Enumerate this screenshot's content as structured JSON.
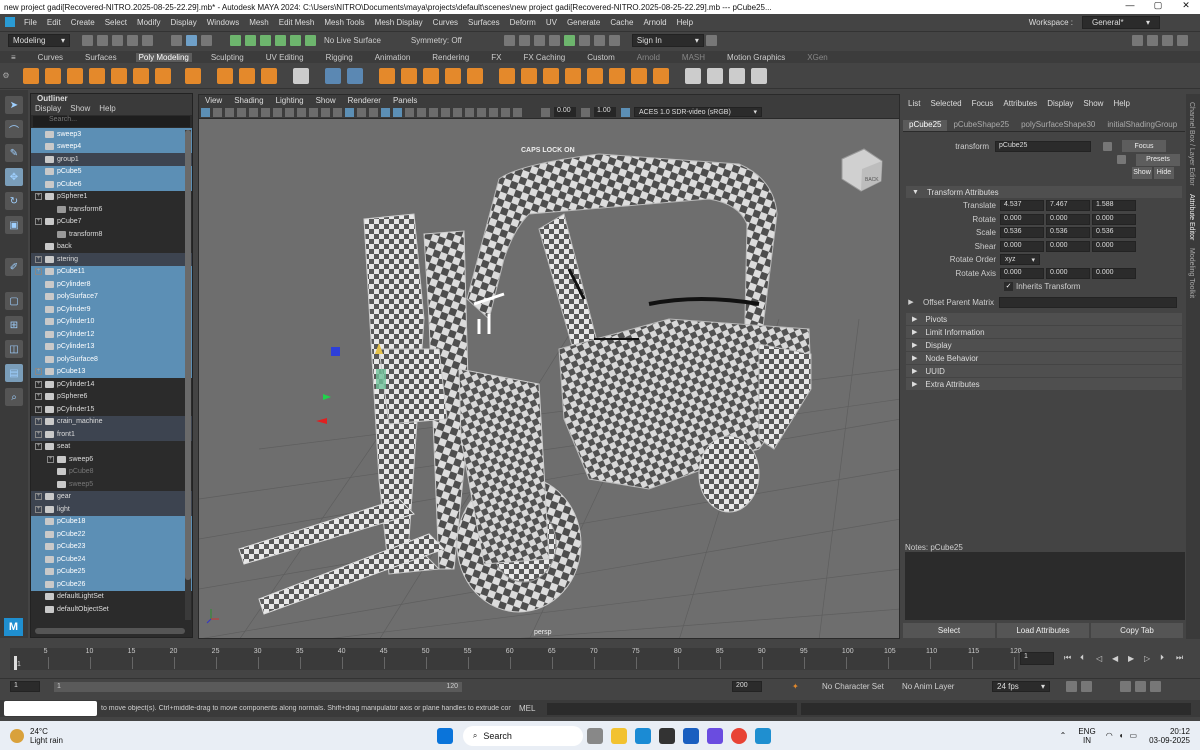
{
  "titlebar": {
    "title": "new project gadi[Recovered-NITRO.2025-08-25-22.29].mb* - Autodesk MAYA 2024: C:\\Users\\NITRO\\Documents\\maya\\projects\\default\\scenes\\new project gadi[Recovered-NITRO.2025-08-25-22.29].mb --- pCube25...",
    "minimize": "—",
    "maximize": "▢",
    "close": "✕"
  },
  "menu": [
    "File",
    "Edit",
    "Create",
    "Select",
    "Modify",
    "Display",
    "Windows",
    "Mesh",
    "Edit Mesh",
    "Mesh Tools",
    "Mesh Display",
    "Curves",
    "Surfaces",
    "Deform",
    "UV",
    "Generate",
    "Cache",
    "Arnold",
    "Help"
  ],
  "workspace": {
    "label": "Workspace :",
    "value": "General*"
  },
  "status": {
    "mode": "Modeling",
    "live_surface": "No Live Surface",
    "symmetry": "Symmetry: Off",
    "sign_in": "Sign In"
  },
  "shelf_tabs": [
    "Curves",
    "Surfaces",
    "Poly Modeling",
    "Sculpting",
    "UV Editing",
    "Rigging",
    "Animation",
    "Rendering",
    "FX",
    "FX Caching",
    "Custom",
    "Arnold",
    "MASH",
    "Motion Graphics",
    "XGen"
  ],
  "shelf_active": "Poly Modeling",
  "outliner": {
    "title": "Outliner",
    "menu": [
      "Display",
      "Show",
      "Help"
    ],
    "search_placeholder": "Search...",
    "items": [
      {
        "label": "sweep3",
        "sel": true,
        "indent": 0,
        "exp": false
      },
      {
        "label": "sweep4",
        "sel": true,
        "indent": 0,
        "exp": false
      },
      {
        "label": "group1",
        "sel": false,
        "indent": 0,
        "exp": false,
        "hl": true
      },
      {
        "label": "pCube5",
        "sel": true,
        "indent": 0,
        "exp": false
      },
      {
        "label": "pCube6",
        "sel": true,
        "indent": 0,
        "exp": false
      },
      {
        "label": "pSphere1",
        "sel": false,
        "indent": 0,
        "exp": true
      },
      {
        "label": "transform6",
        "sel": false,
        "indent": 1,
        "exp": false,
        "xf": true
      },
      {
        "label": "pCube7",
        "sel": false,
        "indent": 0,
        "exp": true
      },
      {
        "label": "transform8",
        "sel": false,
        "indent": 1,
        "exp": false,
        "xf": true
      },
      {
        "label": "back",
        "sel": false,
        "indent": 0,
        "exp": false
      },
      {
        "label": "stering",
        "sel": false,
        "indent": 0,
        "exp": true,
        "hl": true
      },
      {
        "label": "pCube11",
        "sel": true,
        "indent": 0,
        "exp": true
      },
      {
        "label": "pCylinder8",
        "sel": true,
        "indent": 0,
        "exp": false
      },
      {
        "label": "polySurface7",
        "sel": true,
        "indent": 0,
        "exp": false
      },
      {
        "label": "pCylinder9",
        "sel": true,
        "indent": 0,
        "exp": false
      },
      {
        "label": "pCylinder10",
        "sel": true,
        "indent": 0,
        "exp": false
      },
      {
        "label": "pCylinder12",
        "sel": true,
        "indent": 0,
        "exp": false
      },
      {
        "label": "pCylinder13",
        "sel": true,
        "indent": 0,
        "exp": false
      },
      {
        "label": "polySurface8",
        "sel": true,
        "indent": 0,
        "exp": false
      },
      {
        "label": "pCube13",
        "sel": true,
        "indent": 0,
        "exp": true
      },
      {
        "label": "pCylinder14",
        "sel": false,
        "indent": 0,
        "exp": true
      },
      {
        "label": "pSphere6",
        "sel": false,
        "indent": 0,
        "exp": true
      },
      {
        "label": "pCylinder15",
        "sel": false,
        "indent": 0,
        "exp": true
      },
      {
        "label": "crain_machine",
        "sel": false,
        "indent": 0,
        "exp": true,
        "hl": true
      },
      {
        "label": "front1",
        "sel": false,
        "indent": 0,
        "exp": true,
        "hl": true
      },
      {
        "label": "seat",
        "sel": false,
        "indent": 0,
        "exp": true
      },
      {
        "label": "sweep6",
        "sel": false,
        "indent": 1,
        "exp": true
      },
      {
        "label": "pCube8",
        "sel": false,
        "indent": 1,
        "exp": false,
        "dim": true
      },
      {
        "label": "sweep5",
        "sel": false,
        "indent": 1,
        "exp": false,
        "dim": true
      },
      {
        "label": "gear",
        "sel": false,
        "indent": 0,
        "exp": true,
        "hl": true
      },
      {
        "label": "light",
        "sel": false,
        "indent": 0,
        "exp": true,
        "hl": true
      },
      {
        "label": "pCube18",
        "sel": true,
        "indent": 0,
        "exp": false
      },
      {
        "label": "pCube22",
        "sel": true,
        "indent": 0,
        "exp": false
      },
      {
        "label": "pCube23",
        "sel": true,
        "indent": 0,
        "exp": false
      },
      {
        "label": "pCube24",
        "sel": true,
        "indent": 0,
        "exp": false
      },
      {
        "label": "pCube25",
        "sel": true,
        "indent": 0,
        "exp": false
      },
      {
        "label": "pCube26",
        "sel": true,
        "indent": 0,
        "exp": false
      },
      {
        "label": "defaultLightSet",
        "sel": false,
        "indent": 0,
        "exp": false
      },
      {
        "label": "defaultObjectSet",
        "sel": false,
        "indent": 0,
        "exp": false
      }
    ]
  },
  "viewport": {
    "menu": [
      "View",
      "Shading",
      "Lighting",
      "Show",
      "Renderer",
      "Panels"
    ],
    "exposure": "0.00",
    "gamma": "1.00",
    "colorspace": "ACES 1.0 SDR-video (sRGB)",
    "caps": "CAPS LOCK ON",
    "camera": "persp",
    "viewcube": "BACK"
  },
  "attr": {
    "menu": [
      "List",
      "Selected",
      "Focus",
      "Attributes",
      "Display",
      "Show",
      "Help"
    ],
    "tabs": [
      "pCube25",
      "pCubeShape25",
      "polySurfaceShape30",
      "initialShadingGroup"
    ],
    "transform_label": "transform",
    "transform_value": "pCube25",
    "btn_focus": "Focus",
    "btn_presets": "Presets",
    "btn_show": "Show",
    "btn_hide": "Hide",
    "section_transform": "Transform Attributes",
    "translate": {
      "label": "Translate",
      "x": "4.537",
      "y": "7.467",
      "z": "1.588"
    },
    "rotate": {
      "label": "Rotate",
      "x": "0.000",
      "y": "0.000",
      "z": "0.000"
    },
    "scale": {
      "label": "Scale",
      "x": "0.536",
      "y": "0.536",
      "z": "0.536"
    },
    "shear": {
      "label": "Shear",
      "x": "0.000",
      "y": "0.000",
      "z": "0.000"
    },
    "rotate_order": {
      "label": "Rotate Order",
      "value": "xyz"
    },
    "rotate_axis": {
      "label": "Rotate Axis",
      "x": "0.000",
      "y": "0.000",
      "z": "0.000"
    },
    "inherits": "Inherits Transform",
    "offset_parent": "Offset Parent Matrix",
    "sections": [
      "Pivots",
      "Limit Information",
      "Display",
      "Node Behavior",
      "UUID",
      "Extra Attributes"
    ],
    "notes_label": "Notes: pCube25",
    "bottom": [
      "Select",
      "Load Attributes",
      "Copy Tab"
    ]
  },
  "side_tabs": [
    "Channel Box / Layer Editor",
    "Attribute Editor",
    "Modeling Toolkit"
  ],
  "time": {
    "ticks": [
      "1",
      "5",
      "10",
      "15",
      "20",
      "25",
      "30",
      "35",
      "40",
      "45",
      "50",
      "55",
      "60",
      "65",
      "70",
      "75",
      "80",
      "85",
      "90",
      "95",
      "100",
      "105",
      "110",
      "115",
      "120"
    ],
    "current": "1",
    "range_start": "1",
    "range_inner_start": "1",
    "range_inner_end": "120",
    "range_end": "200",
    "character": "No Character Set",
    "anim_layer": "No Anim Layer",
    "fps": "24 fps"
  },
  "cmd": {
    "help": "to move object(s). Ctrl+middle-drag to move components along normals. Shift+drag manipulator axis or plane handles to extrude components or c",
    "lang": "MEL"
  },
  "taskbar": {
    "weather_temp": "24°C",
    "weather_desc": "Light rain",
    "search": "Search",
    "lang1": "ENG",
    "lang2": "IN",
    "time": "20:12",
    "date": "03-09-2025"
  },
  "colors": {
    "selection": "#5c8fb5",
    "accent": "#e4892b",
    "bg": "#444444"
  }
}
